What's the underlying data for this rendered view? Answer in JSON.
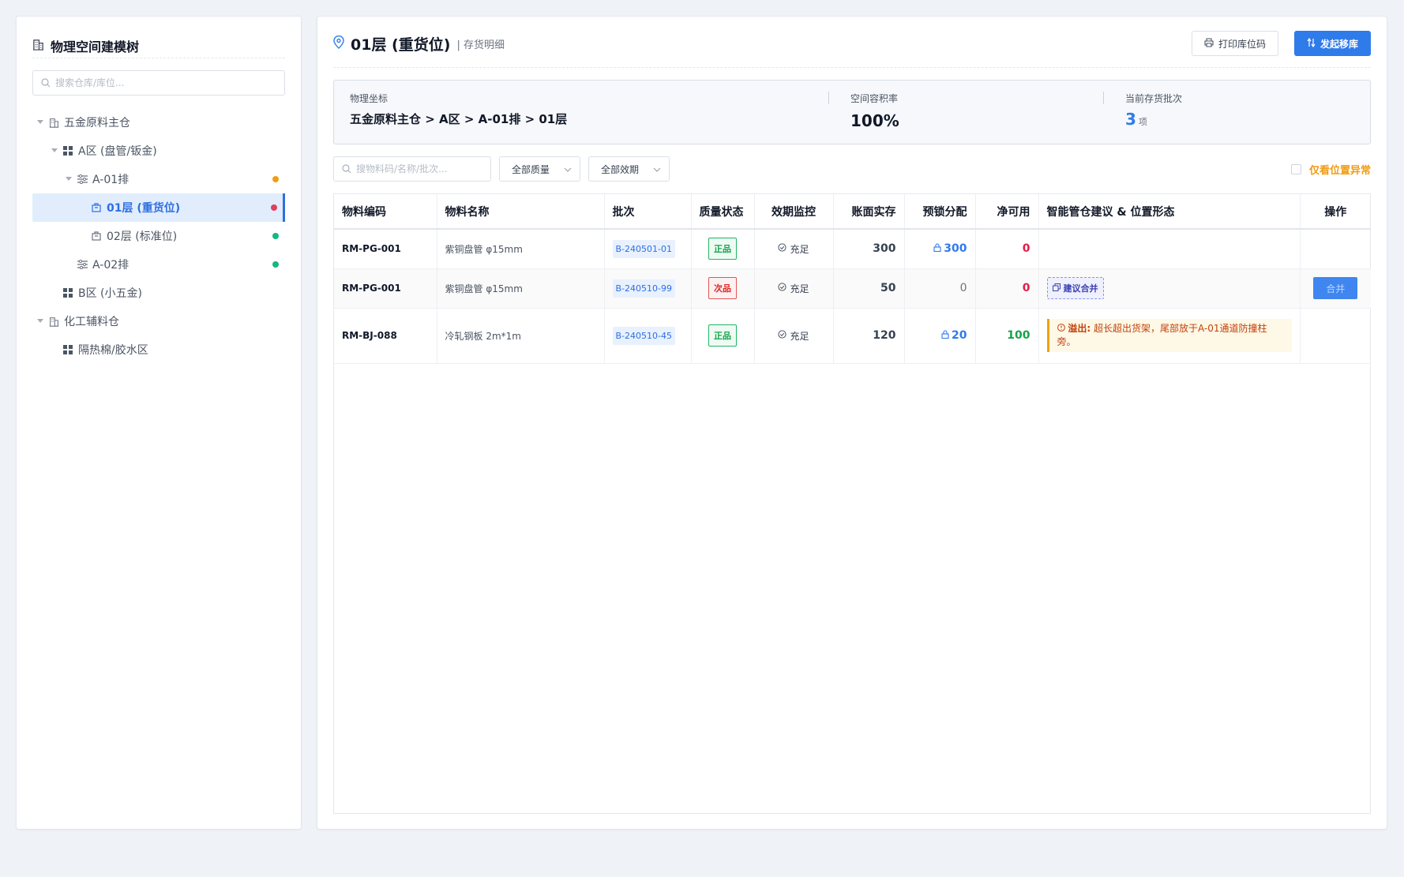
{
  "sidebar": {
    "title": "物理空间建模树",
    "search_placeholder": "搜索仓库/库位...",
    "tree": [
      {
        "label": "五金原料主仓",
        "level": 0,
        "icon": "building-icon",
        "expanded": true
      },
      {
        "label": "A区 (盘管/钣金)",
        "level": 1,
        "icon": "grid-icon",
        "expanded": true
      },
      {
        "label": "A-01排",
        "level": 2,
        "icon": "sliders-icon",
        "expanded": true,
        "status_color": "#f29c12"
      },
      {
        "label": "01层 (重货位)",
        "level": 3,
        "icon": "box-icon",
        "active": true,
        "status_color": "#e0405e"
      },
      {
        "label": "02层 (标准位)",
        "level": 3,
        "icon": "box-icon",
        "status_color": "#10b981"
      },
      {
        "label": "A-02排",
        "level": 2,
        "icon": "sliders-icon",
        "status_color": "#10b981"
      },
      {
        "label": "B区 (小五金)",
        "level": 1,
        "icon": "grid-icon"
      },
      {
        "label": "化工辅料仓",
        "level": 0,
        "icon": "building-icon",
        "expanded": true
      },
      {
        "label": "隔热棉/胶水区",
        "level": 1,
        "icon": "grid-icon"
      }
    ]
  },
  "header": {
    "title": "01层 (重货位)",
    "subtitle": "| 存货明细",
    "print_label": "打印库位码",
    "move_label": "发起移库"
  },
  "stats": {
    "coord_label": "物理坐标",
    "coord_value": "五金原料主仓 > A区 > A-01排 > 01层",
    "capacity_label": "空间容积率",
    "capacity_value": "100%",
    "batch_label": "当前存货批次",
    "batch_value": "3",
    "batch_unit": "项"
  },
  "filters": {
    "search_placeholder": "搜物料码/名称/批次...",
    "quality_select": "全部质量",
    "expiry_select": "全部效期",
    "abnormal_only_label": "仅看位置异常",
    "abnormal_only_checked": false
  },
  "table": {
    "headers": [
      "物料编码",
      "物料名称",
      "批次",
      "质量状态",
      "效期监控",
      "账面实存",
      "预锁分配",
      "净可用",
      "智能管仓建议 & 位置形态",
      "操作"
    ],
    "rows": [
      {
        "code": "RM-PG-001",
        "name": "紫铜盘管 φ15mm",
        "batch": "B-240501-01",
        "quality": "正品",
        "expiry": "充足",
        "stock": "300",
        "locked": "300",
        "available": "0",
        "suggestion": "",
        "action": ""
      },
      {
        "code": "RM-PG-001",
        "name": "紫铜盘管 φ15mm",
        "batch": "B-240510-99",
        "quality": "次品",
        "expiry": "充足",
        "stock": "50",
        "locked": "0",
        "available": "0",
        "suggestion": "建议合并",
        "action": "合并"
      },
      {
        "code": "RM-BJ-088",
        "name": "冷轧钢板 2m*1m",
        "batch": "B-240510-45",
        "quality": "正品",
        "expiry": "充足",
        "stock": "120",
        "locked": "20",
        "available": "100",
        "warning_label": "溢出:",
        "warning_text": "超长超出货架，尾部放于A-01通道防撞柱旁。",
        "action": ""
      }
    ]
  },
  "colors": {
    "accent": "#2f7bea",
    "warning": "#f29c12",
    "danger": "#e11d48",
    "success": "#16a34a"
  }
}
